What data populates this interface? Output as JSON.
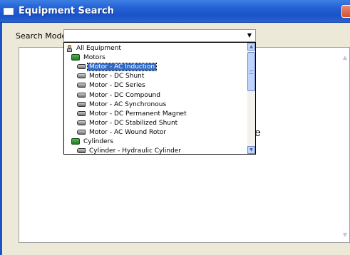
{
  "window": {
    "title": "Equipment Search",
    "title_icon": "window-icon",
    "close_icon": "close-icon"
  },
  "search": {
    "mode_label": "Search Mode",
    "mode_value": "",
    "dropdown_arrow": "▼"
  },
  "results": {
    "partial_text": "e",
    "scroll_up": "▲",
    "scroll_down": "▼"
  },
  "dropdown": {
    "scroll_up": "▲",
    "scroll_down": "▼",
    "items": [
      {
        "label": "All Equipment",
        "icon": "person-icon",
        "level": 0,
        "selected": false
      },
      {
        "label": "Motors",
        "icon": "category-icon",
        "level": 1,
        "selected": false
      },
      {
        "label": "Motor - AC Induction",
        "icon": "equipment-icon",
        "level": 2,
        "selected": true
      },
      {
        "label": "Motor - DC Shunt",
        "icon": "equipment-icon",
        "level": 2,
        "selected": false
      },
      {
        "label": "Motor - DC Series",
        "icon": "equipment-icon",
        "level": 2,
        "selected": false
      },
      {
        "label": "Motor - DC Compound",
        "icon": "equipment-icon",
        "level": 2,
        "selected": false
      },
      {
        "label": "Motor - AC Synchronous",
        "icon": "equipment-icon",
        "level": 2,
        "selected": false
      },
      {
        "label": "Motor - DC Permanent Magnet",
        "icon": "equipment-icon",
        "level": 2,
        "selected": false
      },
      {
        "label": "Motor - DC Stabilized Shunt",
        "icon": "equipment-icon",
        "level": 2,
        "selected": false
      },
      {
        "label": "Motor - AC Wound Rotor",
        "icon": "equipment-icon",
        "level": 2,
        "selected": false
      },
      {
        "label": "Cylinders",
        "icon": "category-icon",
        "level": 1,
        "selected": false
      },
      {
        "label": "Cylinder - Hydraulic Cylinder",
        "icon": "equipment-icon",
        "level": 2,
        "selected": false
      }
    ]
  },
  "colors": {
    "titlebar": "#2461d6",
    "selection": "#316ac5",
    "window_bg": "#ece9d8"
  }
}
